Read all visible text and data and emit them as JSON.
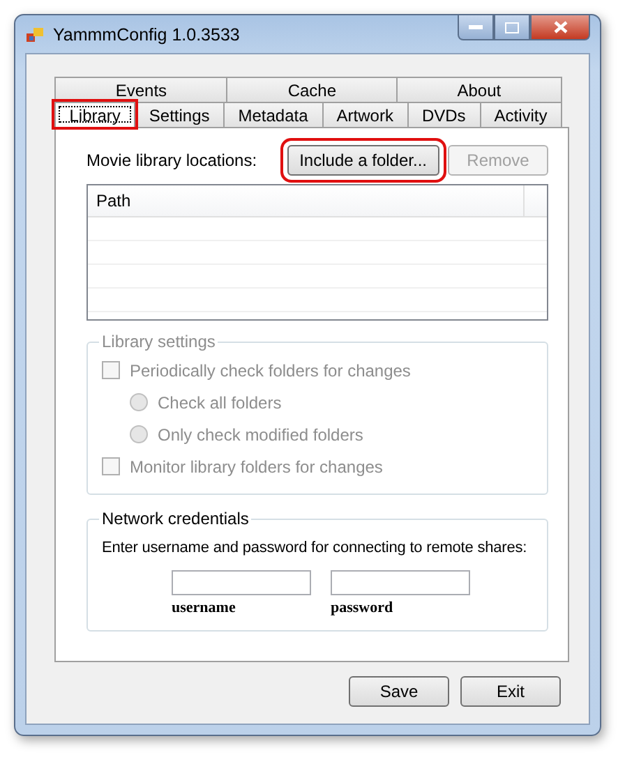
{
  "window": {
    "title": "YammmConfig 1.0.3533"
  },
  "tab_rows": [
    [
      {
        "label": "Events",
        "selected": false
      },
      {
        "label": "Cache",
        "selected": false
      },
      {
        "label": "About",
        "selected": false
      }
    ],
    [
      {
        "label": "Library",
        "selected": true,
        "highlighted": true
      },
      {
        "label": "Settings",
        "selected": false,
        "highlighted": false
      },
      {
        "label": "Metadata",
        "selected": false,
        "highlighted": false
      },
      {
        "label": "Artwork",
        "selected": false,
        "highlighted": false
      },
      {
        "label": "DVDs",
        "selected": false,
        "highlighted": false
      },
      {
        "label": "Activity",
        "selected": false,
        "highlighted": false
      }
    ]
  ],
  "library_locations": {
    "label": "Movie library locations:",
    "buttons": [
      {
        "label": "Include a folder...",
        "disabled": false,
        "highlighted": true
      },
      {
        "label": "Remove",
        "disabled": true,
        "highlighted": false
      }
    ]
  },
  "table": {
    "columns": [
      "Path"
    ]
  },
  "library_settings": {
    "title": "Library settings",
    "disabled": true,
    "options": [
      {
        "kind": "checkbox",
        "label": "Periodically check folders for changes",
        "checked": false,
        "children": [
          {
            "kind": "radio",
            "label": "Check all folders",
            "selected": false
          },
          {
            "kind": "radio",
            "label": "Only check modified folders",
            "selected": false
          }
        ]
      },
      {
        "kind": "checkbox",
        "label": "Monitor library folders for changes",
        "checked": false
      }
    ]
  },
  "network_credentials": {
    "title": "Network credentials",
    "instructions": "Enter username and password for connecting to remote shares:",
    "fields": [
      {
        "label": "username"
      },
      {
        "label": "password"
      }
    ]
  },
  "buttons": [
    {
      "label": "Save"
    },
    {
      "label": "Exit"
    }
  ]
}
